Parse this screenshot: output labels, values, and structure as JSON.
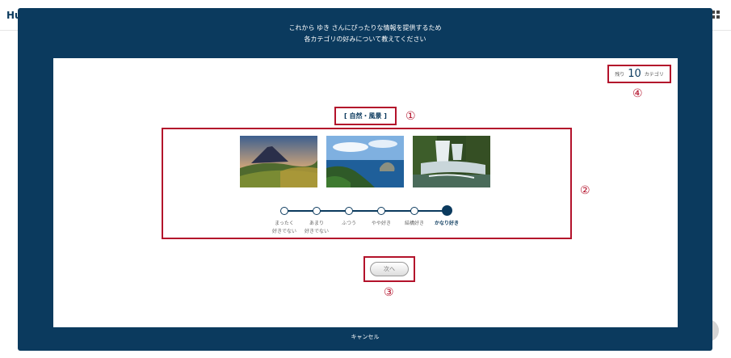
{
  "background": {
    "logo": "Hu"
  },
  "modal": {
    "head_line1": "これから ゆき さんにぴったりな情報を提供するため",
    "head_line2": "各カテゴリの好みについて教えてください",
    "cancel_label": "キャンセル"
  },
  "remaining": {
    "prefix": "残り",
    "count": "10",
    "suffix": "カテゴリ"
  },
  "category": {
    "title": "[ 自然・風景 ]"
  },
  "markers": {
    "m1": "①",
    "m2": "②",
    "m3": "③",
    "m4": "④"
  },
  "photos": [
    {
      "icon": "volcano-mountain-photo"
    },
    {
      "icon": "coastal-sea-photo"
    },
    {
      "icon": "waterfall-photo"
    }
  ],
  "scale": {
    "options": [
      {
        "line1": "まったく",
        "line2": "好きでない"
      },
      {
        "line1": "あまり",
        "line2": "好きでない"
      },
      {
        "line1": "ふつう",
        "line2": ""
      },
      {
        "line1": "やや好き",
        "line2": ""
      },
      {
        "line1": "結構好き",
        "line2": ""
      },
      {
        "line1": "かなり好き",
        "line2": ""
      }
    ],
    "selected_index": 5
  },
  "next_button": {
    "label": "次へ"
  },
  "colors": {
    "navy": "#0b3a5e",
    "highlight": "#b3122b"
  }
}
